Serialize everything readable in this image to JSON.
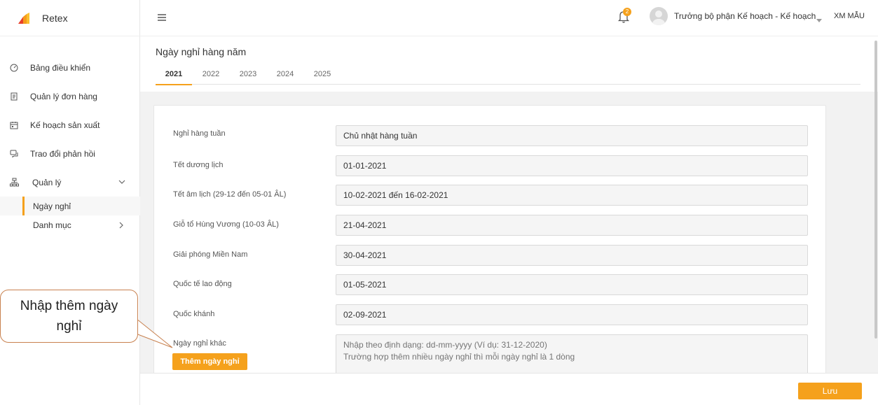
{
  "brand": {
    "name": "Retex"
  },
  "sidebar": {
    "items": [
      {
        "label": "Bảng điều khiển",
        "icon": "dashboard-icon"
      },
      {
        "label": "Quản lý đơn hàng",
        "icon": "document-icon"
      },
      {
        "label": "Kế hoạch sản xuất",
        "icon": "calendar-icon"
      },
      {
        "label": "Trao đổi phản hồi",
        "icon": "chat-icon"
      },
      {
        "label": "Quản lý",
        "icon": "org-chart-icon",
        "expanded": true
      }
    ],
    "subitems": [
      {
        "label": "Ngày nghỉ",
        "active": true
      },
      {
        "label": "Danh mục",
        "active": false
      }
    ]
  },
  "topbar": {
    "notification_count": "2",
    "user_name": "Trưởng bộ phận Kế hoạch - Kế hoạch",
    "company": "XM MẪU"
  },
  "page": {
    "title": "Ngày nghỉ hàng năm",
    "tabs": [
      "2021",
      "2022",
      "2023",
      "2024",
      "2025"
    ],
    "active_tab": "2021"
  },
  "form": {
    "rows": [
      {
        "label": "Nghỉ hàng tuần",
        "value": "Chủ nhật hàng tuần"
      },
      {
        "label": "Tết dương lịch",
        "value": "01-01-2021"
      },
      {
        "label": "Tết âm lịch (29-12 đến 05-01 ÂL)",
        "value": "10-02-2021 đến 16-02-2021"
      },
      {
        "label": "Giỗ tổ Hùng Vương (10-03 ÂL)",
        "value": "21-04-2021"
      },
      {
        "label": "Giải phóng Miền Nam",
        "value": "30-04-2021"
      },
      {
        "label": "Quốc tế lao động",
        "value": "01-05-2021"
      },
      {
        "label": "Quốc khánh",
        "value": "02-09-2021"
      }
    ],
    "other": {
      "label": "Ngày nghỉ khác",
      "placeholder": "Nhập theo định dạng: dd-mm-yyyy (Ví dụ: 31-12-2020)\nTrường hợp thêm nhiều ngày nghỉ thì mỗi ngày nghỉ là 1 dòng",
      "add_button": "Thêm ngày nghỉ"
    }
  },
  "footer": {
    "save_label": "Lưu"
  },
  "annotation": {
    "callout_text": "Nhập thêm ngày nghỉ"
  },
  "colors": {
    "accent": "#f5a11c",
    "callout_border": "#c8814f"
  }
}
